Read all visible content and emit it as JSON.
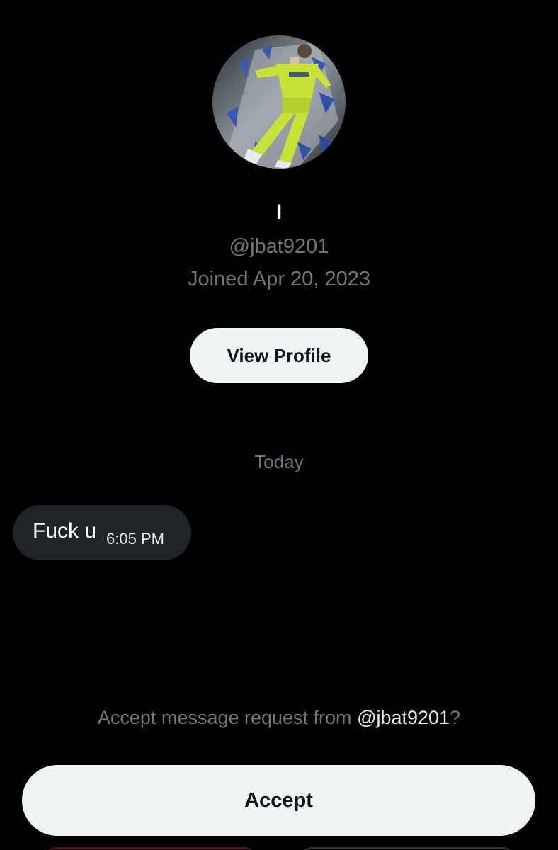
{
  "profile": {
    "display_name": "I",
    "handle": "@jbat9201",
    "joined": "Joined Apr 20, 2023",
    "avatar_icon": "profile-photo-goalkeeper-on-shattered-glass",
    "view_profile_label": "View Profile"
  },
  "conversation": {
    "date_separator": "Today",
    "messages": [
      {
        "text": "Fuck u",
        "time": "6:05 PM"
      }
    ]
  },
  "request": {
    "prompt_prefix": "Accept message request from ",
    "prompt_handle": "@jbat9201",
    "prompt_suffix": "?",
    "accept_label": "Accept"
  },
  "colors": {
    "background": "#000000",
    "primary_text": "#e7e9ea",
    "secondary_text": "#71767b",
    "button_bg": "#eff3f4",
    "bubble_bg": "#202327",
    "danger_outline": "#5a1418"
  }
}
